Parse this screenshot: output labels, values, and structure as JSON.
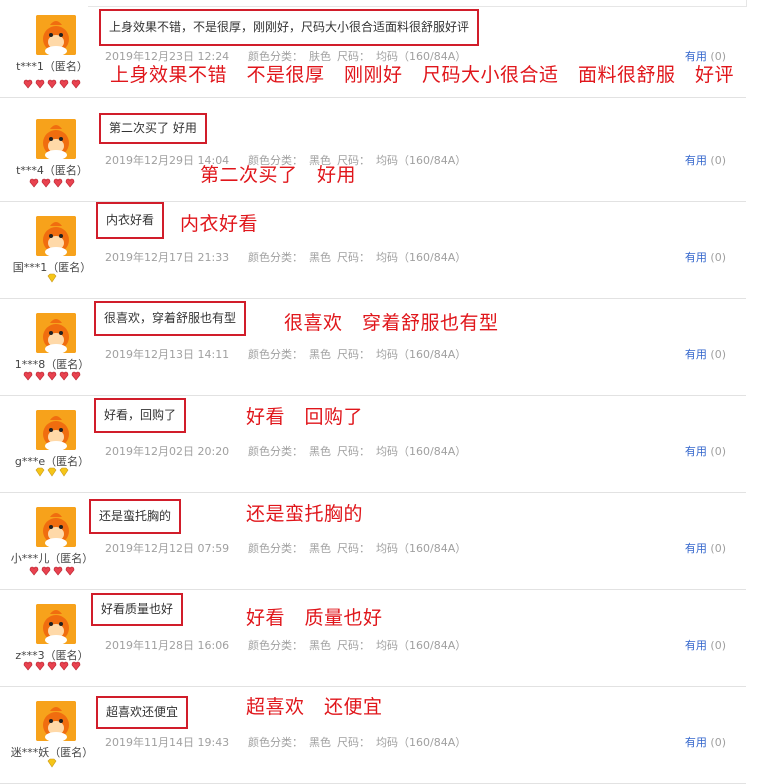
{
  "colors": {
    "annotation": "#e0161b",
    "box_border": "#d11d2a",
    "avatar_bg": "#f7a21b",
    "useful_link": "#3366cc",
    "meta_text": "#a0a0a0"
  },
  "color_label": "颜色分类：",
  "size_label": "尺码：",
  "useful_label": "有用",
  "reviews": [
    {
      "username": "t***1（匿名）",
      "rank_icon": "red-heart-gem-icon",
      "rank_count": 5,
      "content": "上身效果不错，不是很厚，刚刚好，尺码大小很合适面料很舒服好评",
      "date": "2019年12月23日 12:24",
      "color": "肤色",
      "size": "均码（160/84A）",
      "useful": "(0)",
      "annotation": "上身效果不错　不是很厚　刚刚好　尺码大小很合适　面料很舒服　好评"
    },
    {
      "username": "t***4（匿名）",
      "rank_icon": "red-heart-gem-icon",
      "rank_count": 4,
      "content": "第二次买了 好用",
      "date": "2019年12月29日 14:04",
      "color": "黑色",
      "size": "均码（160/84A）",
      "useful": "(0)",
      "annotation": "第二次买了　好用"
    },
    {
      "username": "国***1（匿名）",
      "rank_icon": "yellow-diamond-icon",
      "rank_count": 1,
      "content": "内衣好看",
      "date": "2019年12月17日 21:33",
      "color": "黑色",
      "size": "均码（160/84A）",
      "useful": "(0)",
      "annotation": "内衣好看"
    },
    {
      "username": "1***8（匿名）",
      "rank_icon": "red-heart-gem-icon",
      "rank_count": 5,
      "content": "很喜欢，穿着舒服也有型",
      "date": "2019年12月13日 14:11",
      "color": "黑色",
      "size": "均码（160/84A）",
      "useful": "(0)",
      "annotation": "很喜欢　穿着舒服也有型"
    },
    {
      "username": "g***e（匿名）",
      "rank_icon": "yellow-diamond-icon",
      "rank_count": 3,
      "content": "好看，回购了",
      "date": "2019年12月02日 20:20",
      "color": "黑色",
      "size": "均码（160/84A）",
      "useful": "(0)",
      "annotation": "好看　回购了"
    },
    {
      "username": "小***儿（匿名）",
      "rank_icon": "red-heart-gem-icon",
      "rank_count": 4,
      "content": "还是蛮托胸的",
      "date": "2019年12月12日 07:59",
      "color": "黑色",
      "size": "均码（160/84A）",
      "useful": "(0)",
      "annotation": "还是蛮托胸的"
    },
    {
      "username": "z***3（匿名）",
      "rank_icon": "red-heart-gem-icon",
      "rank_count": 5,
      "content": "好看质量也好",
      "date": "2019年11月28日 16:06",
      "color": "黑色",
      "size": "均码（160/84A）",
      "useful": "(0)",
      "annotation": "好看　质量也好"
    },
    {
      "username": "迷***妖（匿名）",
      "rank_icon": "yellow-diamond-icon",
      "rank_count": 1,
      "content": "超喜欢还便宜",
      "date": "2019年11月14日 19:43",
      "color": "黑色",
      "size": "均码（160/84A）",
      "useful": "(0)",
      "annotation": "超喜欢　还便宜"
    }
  ]
}
